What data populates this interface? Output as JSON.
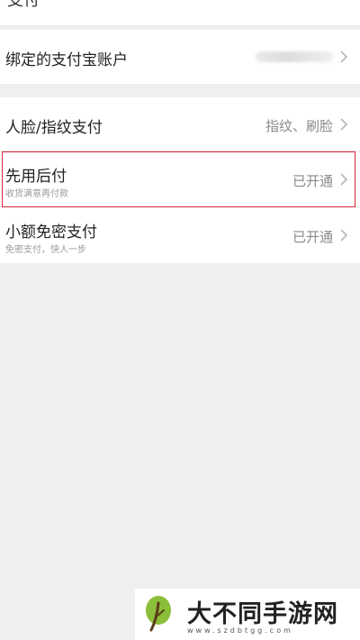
{
  "top_partial": {
    "text": "支付"
  },
  "account": {
    "label": "绑定的支付宝账户"
  },
  "methods": [
    {
      "label": "人脸/指纹支付",
      "subtitle": "",
      "value": "指纹、刷脸"
    },
    {
      "label": "先用后付",
      "subtitle": "收货满意再付款",
      "value": "已开通"
    },
    {
      "label": "小额免密支付",
      "subtitle": "免密支付，快人一步",
      "value": "已开通"
    }
  ],
  "watermark": {
    "text": "大不同手游网",
    "url": "www.szdbtgg.com"
  },
  "colors": {
    "highlight": "#d42a3a",
    "logo_green": "#8bbf3a",
    "background": "#efefef"
  },
  "icons": {
    "chevron": "chevron-right-icon",
    "logo": "leaf-logo-icon"
  }
}
